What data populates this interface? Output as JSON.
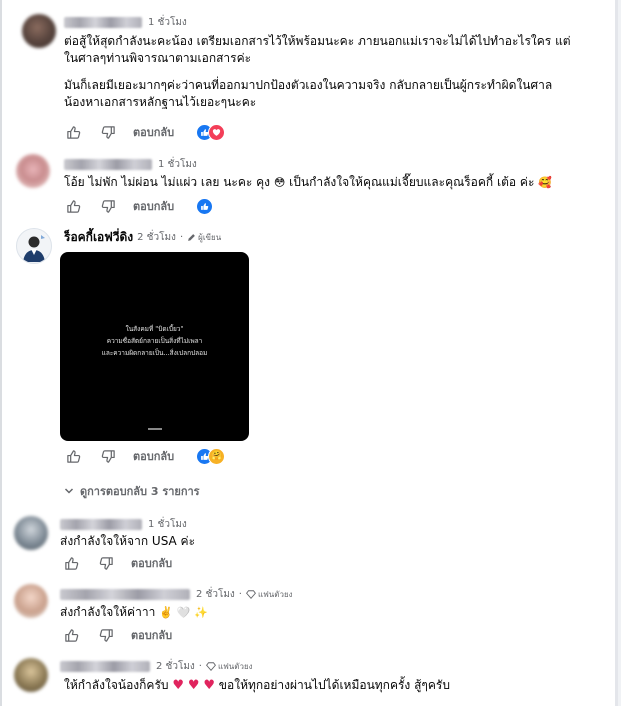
{
  "comments": [
    {
      "time": "1 ชั่วโมง",
      "lines": [
        "ต่อสู้ให้สุดกำลังนะคะน้อง เตรียมเอกสารไว้ให้พร้อมนะคะ ภายนอกแม่เราจะไม่ได้ไปทำอะไรใคร แต่",
        "ในศาลๆท่านพิจารณาตามเอกสารค่ะ",
        "มันก็เลยมีเยอะมากๆค่ะว่าคนที่ออกมาปกป้องตัวเองในความจริง กลับกลายเป็นผู้กระทำผิดในศาล",
        "น้องหาเอกสารหลักฐานไว้เยอะๆนะคะ"
      ],
      "reply_label": "ตอบกลับ"
    },
    {
      "time": "1 ชั่วโมง",
      "text_a": "โอ้ย ไม่พัก ไม่ผ่อน ไม่แผ่ว เลย นะคะ คุง",
      "text_b": "เป็นกำลังใจให้คุณแม่เจี๊ยบและคุณร็อคกี้ เต้อ ค่ะ",
      "reply_label": "ตอบกลับ"
    },
    {
      "author": "ร็อคกี้เอฟวี่ดิง",
      "time": "2 ชั่วโมง",
      "role": "ผู้เขียน",
      "video_lines": [
        "ในสังคมที่ \"บิดเบี้ยว\"",
        "ความซื่อสัตย์กลายเป็นสิ่งที่ไม่เพลา",
        "และความผิดกลายเป็น...สิ่งเปลกปลอม"
      ],
      "reply_label": "ตอบกลับ"
    },
    {
      "time": "1 ชั่วโมง",
      "text": "ส่งกำลังใจให้จาก USA ค่ะ",
      "reply_label": "ตอบกลับ"
    },
    {
      "time": "2 ชั่วโมง",
      "badge": "แฟนตัวยง",
      "text": "ส่งกำลังใจให้ค่าาา",
      "reply_label": "ตอบกลับ"
    },
    {
      "time": "2 ชั่วโมง",
      "badge": "แฟนตัวยง",
      "text_a": "ให้กำลังใจน้องก็ครับ",
      "text_b": "ขอให้ทุกอย่างผ่านไปได้เหมือนทุกครั้ง สู้ๆครับ"
    }
  ],
  "view_replies": "ดูการตอบกลับ 3 รายการ",
  "separator": "·",
  "colors": {
    "like": "#1877f2",
    "love": "#f33e58",
    "secondary": "#65676b"
  }
}
